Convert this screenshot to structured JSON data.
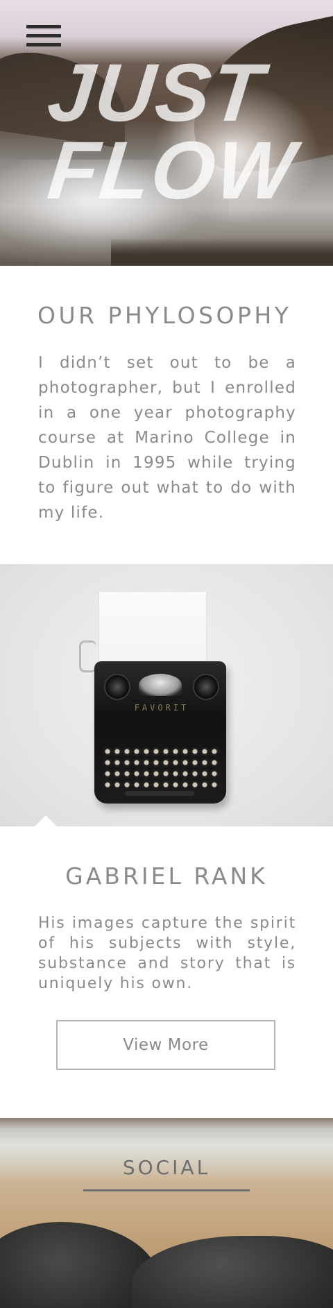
{
  "hero": {
    "title_line1": "JUST",
    "title_line2": "FLOW"
  },
  "philosophy": {
    "heading": "OUR PHYLOSOPHY",
    "body": "I didn’t set out to be a photographer, but I enrolled in a one year photography course at Marino College in Dublin in 1995 while trying to figure out what to do with my life."
  },
  "typewriter": {
    "brand": "FAVORIT"
  },
  "profile": {
    "heading": "GABRIEL RANK",
    "body": "His images capture the spirit of his subjects with style, substance and story that is uniquely his own.",
    "button_label": "View More"
  },
  "social": {
    "heading": "SOCIAL"
  },
  "icons": {
    "menu": "hamburger-menu-icon"
  }
}
